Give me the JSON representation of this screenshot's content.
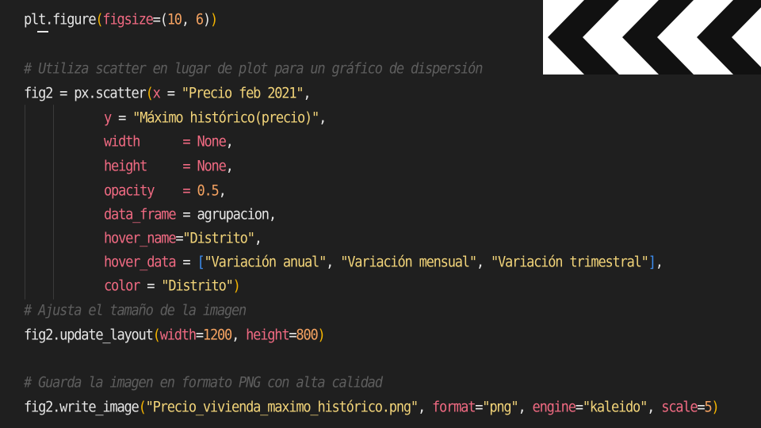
{
  "code": {
    "line1": {
      "a": "plt.figure",
      "b": "(",
      "c": "figsize",
      "d": "=",
      "e": "(",
      "f": "10",
      "g": ", ",
      "h": "6",
      "i": ")",
      "j": ")"
    },
    "comment1": "# Utiliza scatter en lugar de plot para un gráfico de dispersión",
    "line_fig2": {
      "a": "fig2 = px.scatter",
      "b": "(",
      "c": "x",
      "d": " = ",
      "e": "\"Precio feb 2021\"",
      "f": ","
    },
    "line_y": {
      "a": "y",
      "b": " = ",
      "c": "\"Máximo histórico(precio)\"",
      "d": ","
    },
    "line_width": {
      "a": "width",
      "b": "      = ",
      "c": "None",
      "d": ","
    },
    "line_height": {
      "a": "height",
      "b": "     = ",
      "c": "None",
      "d": ","
    },
    "line_opacity": {
      "a": "opacity",
      "b": "    = ",
      "c": "0.5",
      "d": ","
    },
    "line_data_frame": {
      "a": "data_frame",
      "b": " = ",
      "c": "agrupacion",
      "d": ","
    },
    "line_hover_name": {
      "a": "hover_name",
      "b": "=",
      "c": "\"Distrito\"",
      "d": ","
    },
    "line_hover_data": {
      "a": "hover_data",
      "b": " = ",
      "c": "[",
      "d": "\"Variación anual\"",
      "e": ", ",
      "f": "\"Variación mensual\"",
      "g": ", ",
      "h": "\"Variación trimestral\"",
      "i": "]",
      "j": ","
    },
    "line_color": {
      "a": "color",
      "b": " = ",
      "c": "\"Distrito\"",
      "d": ")"
    },
    "comment2": "# Ajusta el tamaño de la imagen",
    "line_update": {
      "a": "fig2.update_layout",
      "b": "(",
      "c": "width",
      "d": "=",
      "e": "1200",
      "f": ", ",
      "g": "height",
      "h": "=",
      "i": "800",
      "j": ")"
    },
    "comment3": "# Guarda la imagen en formato PNG con alta calidad",
    "line_write": {
      "a": "fig2.write_image",
      "b": "(",
      "c": "\"Precio_vivienda_maximo_histórico.png\"",
      "d": ", ",
      "e": "format",
      "f": "=",
      "g": "\"png\"",
      "h": ", ",
      "i": "engine",
      "j": "=",
      "k": "\"kaleido\"",
      "l": ", ",
      "m": "scale",
      "n": "=",
      "o": "5",
      "p": ")"
    }
  },
  "colors": {
    "background": "#1f1f1f",
    "string": "#f2d479",
    "number": "#f4a261",
    "keyword_arg": "#f06a82",
    "punctuation": "#f4b400",
    "comment": "#5e5e5e"
  },
  "logo": {
    "icon": "double-chevron-left-logo"
  }
}
